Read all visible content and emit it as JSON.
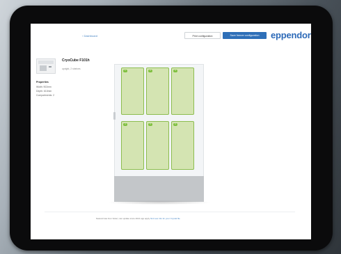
{
  "header": {
    "back_link": "‹ Dashboard",
    "print_label": "Print configuration",
    "save_label": "Save freezer configuration",
    "logo": "eppendorf"
  },
  "product": {
    "name": "CryoCube F101h",
    "subtitle": "upright, 2 shelves",
    "properties_title": "Properties",
    "properties": [
      "Width: 902mm",
      "Depth: 610mm",
      "Compartments: 2"
    ]
  },
  "freezer": {
    "compartments": [
      {
        "label": "1"
      },
      {
        "label": "2"
      },
      {
        "label": "3"
      },
      {
        "label": "4"
      },
      {
        "label": "5"
      },
      {
        "label": "6"
      }
    ]
  },
  "footer": {
    "text": "Natural Gas from Solar | can update since 2021 app apply",
    "link": "find new info for your Crystal file"
  },
  "colors": {
    "brand": "#2d6ab8",
    "compartment_fill": "#d4e4b2",
    "compartment_border": "#8cbd4f"
  }
}
